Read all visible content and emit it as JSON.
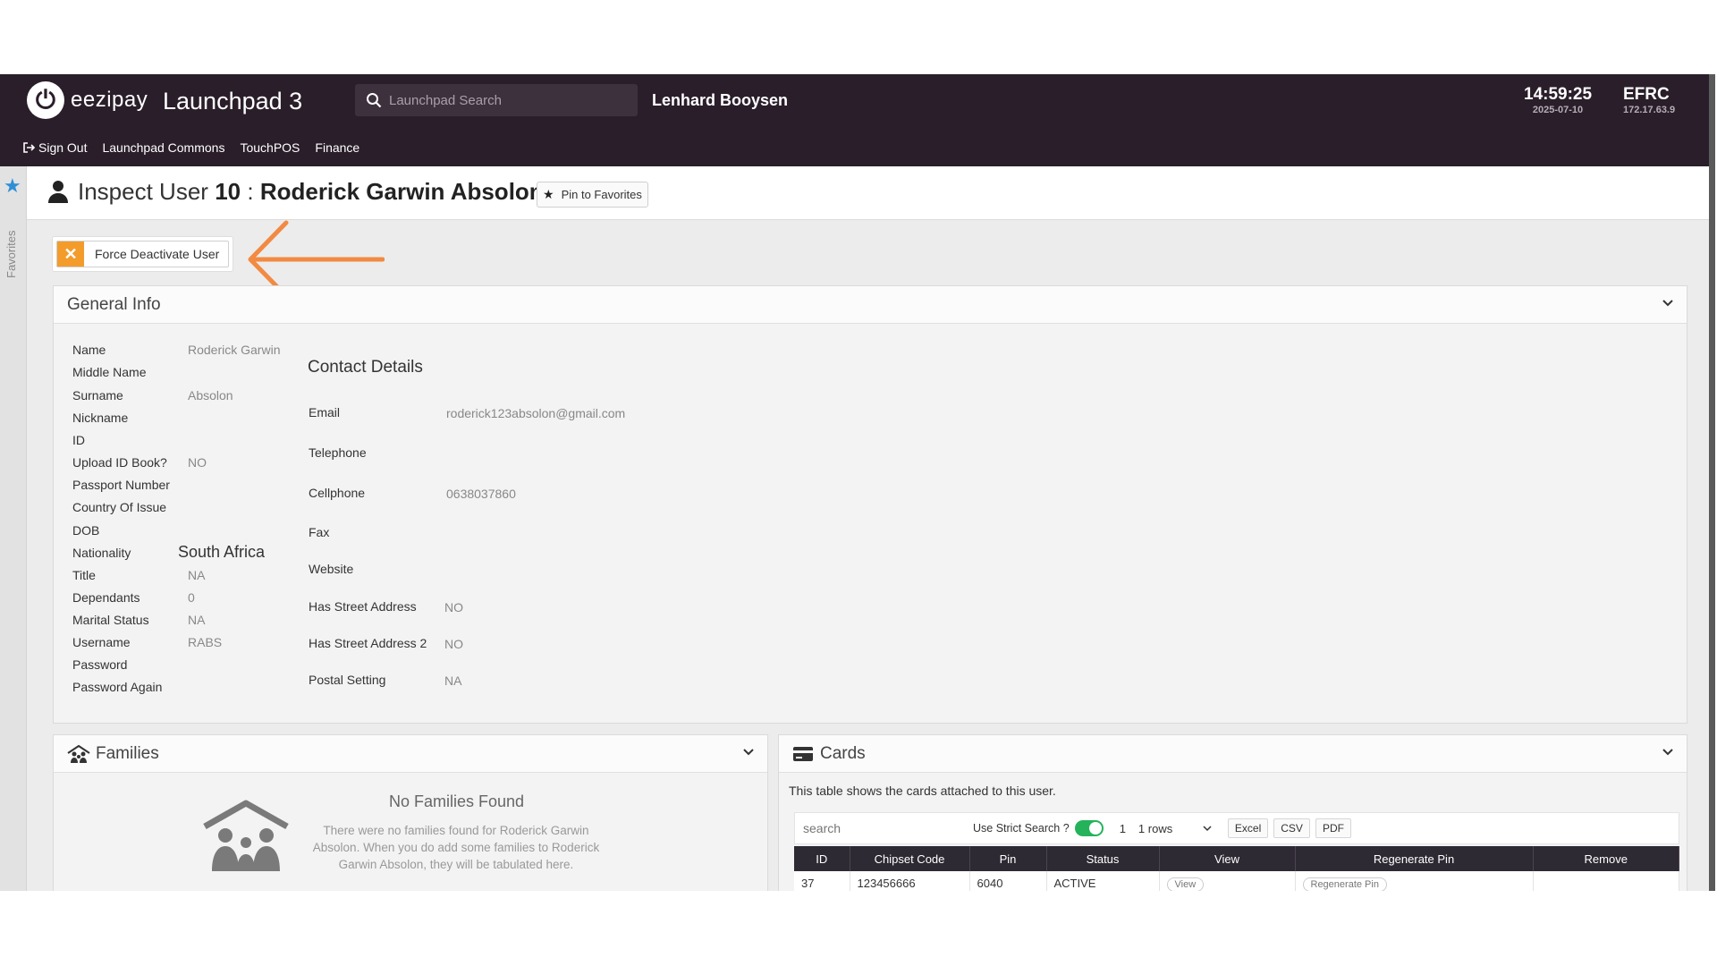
{
  "header": {
    "brand": "eezipay",
    "app_title": "Launchpad 3",
    "search_placeholder": "Launchpad Search",
    "user_name": "Lenhard Booysen",
    "time": "14:59:25",
    "date": "2025-07-10",
    "server_code": "EFRC",
    "server_ip": "172.17.63.9",
    "nav": [
      {
        "label": "Sign Out",
        "icon": "sign-out-icon"
      },
      {
        "label": "Launchpad Commons"
      },
      {
        "label": "TouchPOS"
      },
      {
        "label": "Finance"
      }
    ]
  },
  "rail": {
    "label": "Favorites",
    "icon": "star-icon"
  },
  "page": {
    "title_prefix": "Inspect User",
    "user_id": "10",
    "separator": ":",
    "full_name": "Roderick Garwin Absolon",
    "pin_label": "Pin to Favorites"
  },
  "action": {
    "deactivate_label": "Force Deactivate User",
    "deactivate_icon": "✕"
  },
  "general": {
    "title": "General Info",
    "fields": [
      {
        "label": "Name",
        "value": "Roderick Garwin"
      },
      {
        "label": "Middle Name",
        "value": ""
      },
      {
        "label": "Surname",
        "value": "Absolon"
      },
      {
        "label": "Nickname",
        "value": ""
      },
      {
        "label": "ID",
        "value": ""
      },
      {
        "label": "Upload ID Book?",
        "value": "NO"
      },
      {
        "label": "Passport Number",
        "value": ""
      },
      {
        "label": "Country Of Issue",
        "value": ""
      },
      {
        "label": "DOB",
        "value": ""
      },
      {
        "label": "Nationality",
        "value": "South Africa"
      },
      {
        "label": "Title",
        "value": "NA"
      },
      {
        "label": "Dependants",
        "value": "0"
      },
      {
        "label": "Marital Status",
        "value": "NA"
      },
      {
        "label": "Username",
        "value": "RABS"
      },
      {
        "label": "Password",
        "value": ""
      },
      {
        "label": "Password Again",
        "value": ""
      }
    ],
    "contact_title": "Contact Details",
    "contact": [
      {
        "label": "Email",
        "value": "roderick123absolon@gmail.com"
      },
      {
        "label": "Telephone",
        "value": ""
      },
      {
        "label": "Cellphone",
        "value": "0638037860"
      },
      {
        "label": "Fax",
        "value": ""
      },
      {
        "label": "Website",
        "value": ""
      },
      {
        "label": "Has Street Address",
        "value": "NO"
      },
      {
        "label": "Has Street Address 2",
        "value": "NO"
      },
      {
        "label": "Postal Setting",
        "value": "NA"
      }
    ]
  },
  "families": {
    "title": "Families",
    "empty_title": "No Families Found",
    "empty_text": "There were no families found for Roderick Garwin Absolon. When you do add some families to Roderick Garwin Absolon, they will be tabulated here."
  },
  "cards": {
    "title": "Cards",
    "description": "This table shows the cards attached to this user.",
    "search_placeholder": "search",
    "strict_label": "Use Strict Search ?",
    "page": "1",
    "rows_label": "1 rows",
    "exports": [
      "Excel",
      "CSV",
      "PDF"
    ],
    "columns": [
      "ID",
      "Chipset Code",
      "Pin",
      "Status",
      "View",
      "Regenerate Pin",
      "Remove"
    ],
    "row": {
      "id": "37",
      "chipset": "123456666",
      "pin": "6040",
      "status": "ACTIVE",
      "view": "View",
      "regen": "Regenerate Pin"
    }
  },
  "colors": {
    "header_bg": "#2a1e2a",
    "accent_orange": "#f39c2b",
    "favorites_blue": "#2f8fd6",
    "toggle_green": "#24b35a"
  }
}
